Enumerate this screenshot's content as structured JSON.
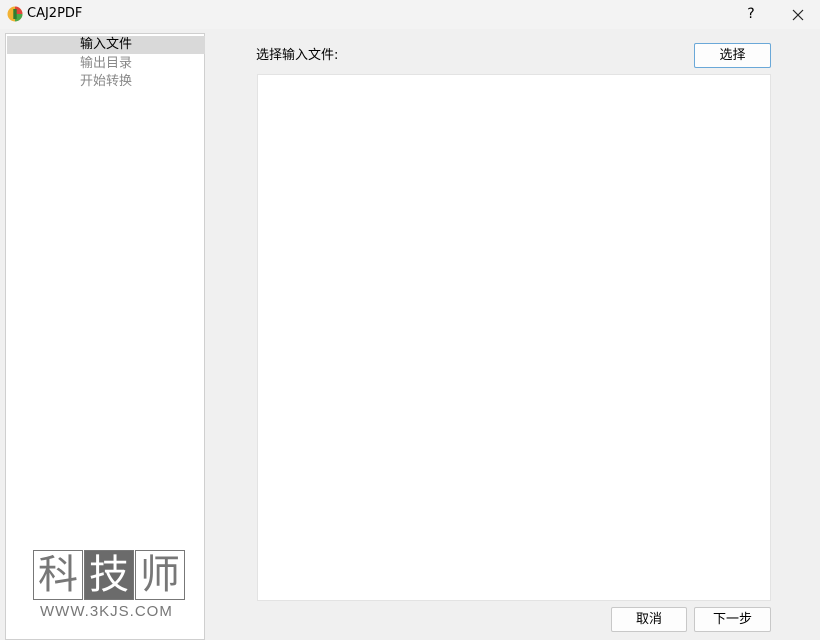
{
  "window": {
    "title": "CAJ2PDF",
    "help_label": "?",
    "close_icon": "close-icon",
    "app_icon": "caj2pdf-app-icon"
  },
  "sidebar": {
    "steps": [
      {
        "label": "输入文件",
        "active": true
      },
      {
        "label": "输出目录",
        "active": false
      },
      {
        "label": "开始转换",
        "active": false
      }
    ]
  },
  "main": {
    "input_label": "选择输入文件:",
    "select_button": "选择",
    "file_list": []
  },
  "footer": {
    "cancel_button": "取消",
    "next_button": "下一步"
  },
  "watermark": {
    "chars": [
      "科",
      "技",
      "师"
    ],
    "url": "WWW.3KJS.COM"
  },
  "colors": {
    "background": "#f0f0f0",
    "active_step": "#d9d9d9",
    "focus_border": "#6aa8d8"
  }
}
